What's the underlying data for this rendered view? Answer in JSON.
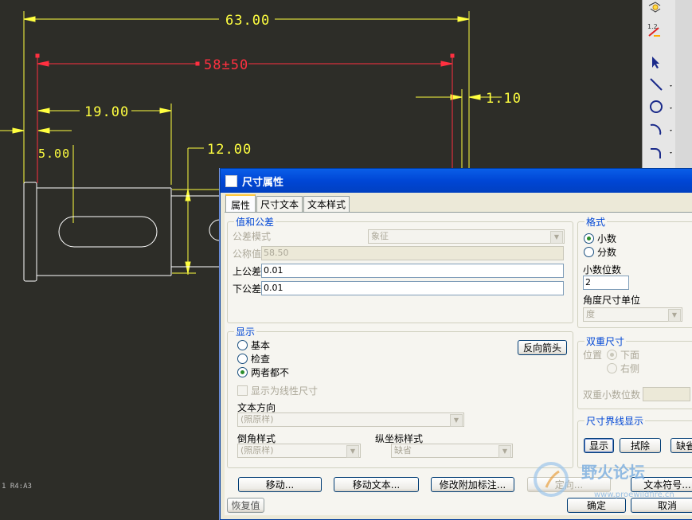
{
  "drawing": {
    "dims": {
      "d63": "63.00",
      "d5850": "58±50",
      "d19": "19.00",
      "d110": "1.10",
      "d12": "12.00",
      "d5": "5.00"
    },
    "status_text": "1  R4:A3",
    "colors": {
      "background": "#2d2d28",
      "dimension": "#ffff40",
      "selected": "#ff3040",
      "geometry": "#ffffff"
    }
  },
  "toolbar": {
    "icons": [
      "dimension-check-icon",
      "dimension-edit-icon",
      "select-arrow-icon",
      "line-icon",
      "circle-icon",
      "arc-icon",
      "fillet-icon"
    ]
  },
  "dialog": {
    "title": "尺寸属性",
    "tabs": [
      "属性",
      "尺寸文本",
      "文本样式"
    ],
    "values": {
      "legend": "值和公差",
      "tolerance_mode_label": "公差模式",
      "tolerance_mode_value": "象征",
      "nominal_label": "公称值",
      "nominal_value": "58.50",
      "upper_label": "上公差",
      "upper_value": "0.01",
      "lower_label": "下公差",
      "lower_value": "0.01"
    },
    "format": {
      "legend": "格式",
      "decimal": "小数",
      "fraction": "分数",
      "decimals_label": "小数位数",
      "decimals_value": "2",
      "angle_label": "角度尺寸单位",
      "angle_value": "度"
    },
    "display": {
      "legend": "显示",
      "basic": "基本",
      "inspection": "检查",
      "neither": "两者都不",
      "flip_arrows": "反向箭头",
      "linear_check": "显示为线性尺寸",
      "text_orient_label": "文本方向",
      "text_orient_value": "(照原样)",
      "chamfer_label": "倒角样式",
      "chamfer_value": "(照原样)",
      "ordinate_label": "纵坐标样式",
      "ordinate_value": "缺省"
    },
    "dual": {
      "legend": "双重尺寸",
      "position_label": "位置",
      "below": "下面",
      "right": "右侧",
      "dual_decimals_label": "双重小数位数"
    },
    "witness": {
      "legend": "尺寸界线显示",
      "show": "显示",
      "erase": "拭除",
      "default": "缺省"
    },
    "buttons": {
      "move": "移动...",
      "move_text": "移动文本...",
      "modify_attach": "修改附加标注...",
      "orient": "定向...",
      "text_symbol": "文本符号...",
      "restore": "恢复值",
      "ok": "确定",
      "cancel": "取消"
    }
  },
  "watermark": {
    "text": "野火论坛",
    "url": "www.proewildfire.cn"
  }
}
